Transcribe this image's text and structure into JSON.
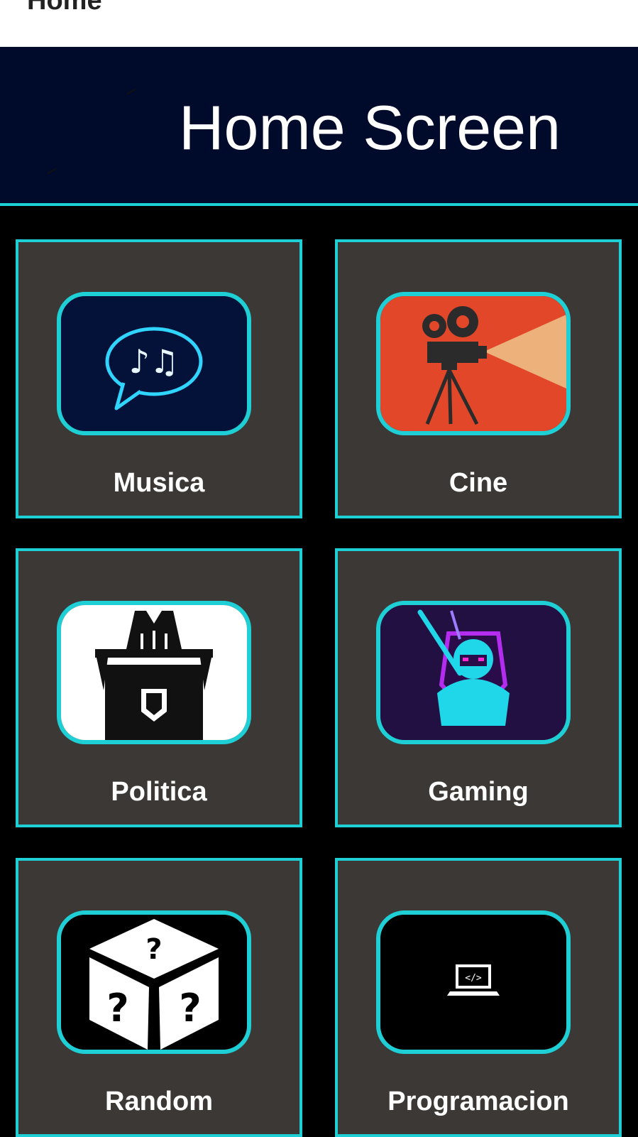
{
  "appbar": {
    "title": "Home"
  },
  "header": {
    "title": "Home Screen"
  },
  "categories": [
    {
      "label": "Musica",
      "icon": "music-notes-icon"
    },
    {
      "label": "Cine",
      "icon": "film-projector-icon"
    },
    {
      "label": "Politica",
      "icon": "podium-icon"
    },
    {
      "label": "Gaming",
      "icon": "ninja-gamer-icon"
    },
    {
      "label": "Random",
      "icon": "question-dice-icon"
    },
    {
      "label": "Programacion",
      "icon": "code-laptop-icon"
    }
  ],
  "code_glyph": "</>",
  "colors": {
    "accent": "#1ecfd6",
    "header_bg": "#000a2a",
    "card_bg": "#3c3836",
    "page_bg": "#000000"
  }
}
